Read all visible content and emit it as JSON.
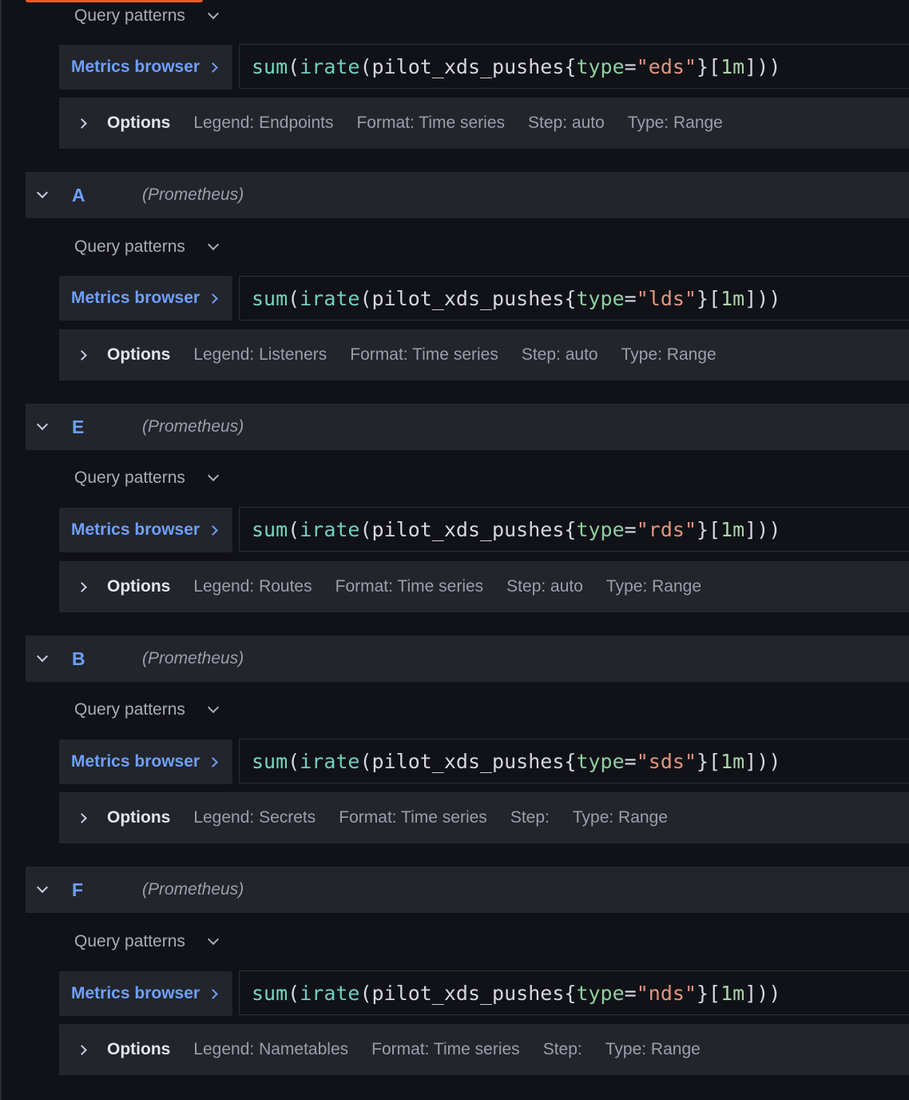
{
  "colors": {
    "accent": "#f05a28",
    "link": "#6e9fff",
    "background": "#111217",
    "panel": "#22252b"
  },
  "query_patterns_label": "Query patterns",
  "metrics_browser_label": "Metrics browser",
  "options_label": "Options",
  "queries": [
    {
      "refid": "",
      "datasource": "",
      "query": {
        "fn": "sum",
        "inner": "irate",
        "metric": "pilot_xds_pushes",
        "label": "type",
        "value": "eds",
        "range": "1m"
      },
      "options": {
        "legend": "Legend: Endpoints",
        "format": "Format: Time series",
        "step": "Step: auto",
        "type": "Type: Range"
      }
    },
    {
      "refid": "A",
      "datasource": "(Prometheus)",
      "query": {
        "fn": "sum",
        "inner": "irate",
        "metric": "pilot_xds_pushes",
        "label": "type",
        "value": "lds",
        "range": "1m"
      },
      "options": {
        "legend": "Legend: Listeners",
        "format": "Format: Time series",
        "step": "Step: auto",
        "type": "Type: Range"
      }
    },
    {
      "refid": "E",
      "datasource": "(Prometheus)",
      "query": {
        "fn": "sum",
        "inner": "irate",
        "metric": "pilot_xds_pushes",
        "label": "type",
        "value": "rds",
        "range": "1m"
      },
      "options": {
        "legend": "Legend: Routes",
        "format": "Format: Time series",
        "step": "Step: auto",
        "type": "Type: Range"
      }
    },
    {
      "refid": "B",
      "datasource": "(Prometheus)",
      "query": {
        "fn": "sum",
        "inner": "irate",
        "metric": "pilot_xds_pushes",
        "label": "type",
        "value": "sds",
        "range": "1m"
      },
      "options": {
        "legend": "Legend: Secrets",
        "format": "Format: Time series",
        "step": "Step:",
        "type": "Type: Range"
      }
    },
    {
      "refid": "F",
      "datasource": "(Prometheus)",
      "query": {
        "fn": "sum",
        "inner": "irate",
        "metric": "pilot_xds_pushes",
        "label": "type",
        "value": "nds",
        "range": "1m"
      },
      "options": {
        "legend": "Legend: Nametables",
        "format": "Format: Time series",
        "step": "Step:",
        "type": "Type: Range"
      }
    }
  ],
  "icons": {
    "collapse": "chevron-down-icon",
    "metrics_browser": "chevron-right-icon",
    "options": "chevron-right-icon",
    "query_patterns": "chevron-down-icon"
  }
}
